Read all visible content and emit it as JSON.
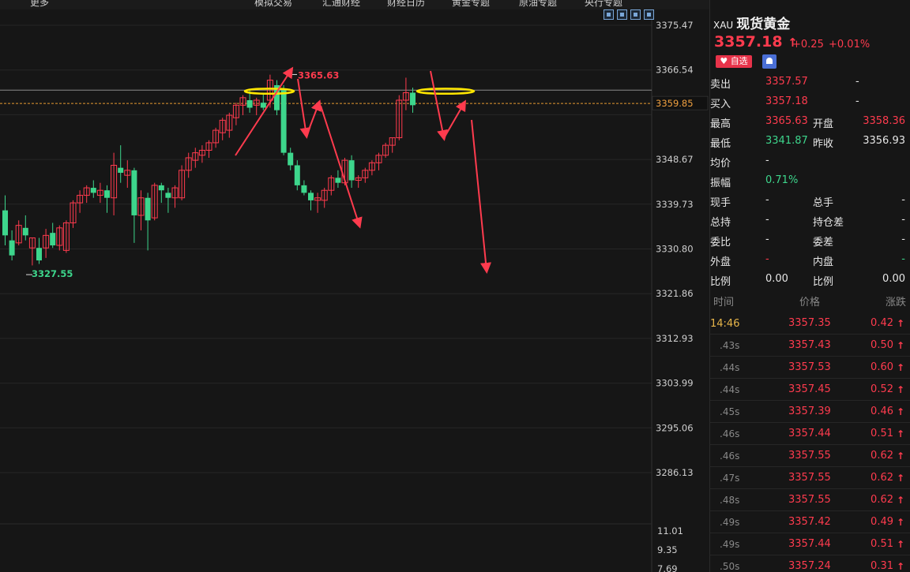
{
  "toolbar": {
    "items": [
      "更多",
      "模拟交易",
      "汇通财经",
      "财经日历",
      "黄金专题",
      "原油专题",
      "央行专题"
    ]
  },
  "chart_data": {
    "type": "candlestick",
    "y_ticks": [
      "3375.47",
      "3366.54",
      "3359.85",
      "3348.67",
      "3339.73",
      "3330.80",
      "3321.86",
      "3312.93",
      "3303.99",
      "3295.06",
      "3286.13"
    ],
    "volume_ticks": [
      "11.01",
      "9.35",
      "7.69"
    ],
    "current_price_label": "3359.85",
    "high_label": "3365.63",
    "low_label": "3327.55",
    "colors": {
      "up": "#ff3b4e",
      "down": "#3dd68c",
      "annotation": "#ff3b4e",
      "highlight": "#ffe600"
    }
  },
  "quote": {
    "code": "XAU",
    "name": "现货黄金",
    "price": "3357.18",
    "price_arrow": "↑",
    "change": "+0.25",
    "change_pct": "+0.01%",
    "fav_label": "自选",
    "stats": [
      {
        "l1": "卖出",
        "v1": "3357.57",
        "c1": "red",
        "l2": "",
        "v2": "-",
        "c2": "white"
      },
      {
        "l1": "买入",
        "v1": "3357.18",
        "c1": "red",
        "l2": "",
        "v2": "-",
        "c2": "white"
      },
      {
        "l1": "最高",
        "v1": "3365.63",
        "c1": "red",
        "l2": "开盘",
        "v2": "3358.36",
        "c2": "red"
      },
      {
        "l1": "最低",
        "v1": "3341.87",
        "c1": "green",
        "l2": "昨收",
        "v2": "3356.93",
        "c2": "white"
      },
      {
        "l1": "均价",
        "v1": "-",
        "c1": "white",
        "l2": "",
        "v2": "",
        "c2": "white"
      },
      {
        "l1": "振幅",
        "v1": "0.71%",
        "c1": "green",
        "l2": "",
        "v2": "",
        "c2": "white"
      },
      {
        "l1": "现手",
        "v1": "-",
        "c1": "white",
        "l2": "总手",
        "v2": "-",
        "c2": "white"
      },
      {
        "l1": "总持",
        "v1": "-",
        "c1": "white",
        "l2": "持仓差",
        "v2": "-",
        "c2": "white"
      },
      {
        "l1": "委比",
        "v1": "-",
        "c1": "white",
        "l2": "委差",
        "v2": "-",
        "c2": "white"
      },
      {
        "l1": "外盘",
        "v1": "-",
        "c1": "red",
        "l2": "内盘",
        "v2": "-",
        "c2": "green"
      },
      {
        "l1": "比例",
        "v1": "0.00",
        "c1": "white",
        "l2": "比例",
        "v2": "0.00",
        "c2": "white"
      }
    ]
  },
  "ticks": {
    "headers": [
      "时间",
      "价格",
      "涨跌"
    ],
    "rows": [
      {
        "time": "14:46",
        "price": "3357.35",
        "diff": "0.42"
      },
      {
        "time": ".43s",
        "price": "3357.43",
        "diff": "0.50"
      },
      {
        "time": ".44s",
        "price": "3357.53",
        "diff": "0.60"
      },
      {
        "time": ".44s",
        "price": "3357.45",
        "diff": "0.52"
      },
      {
        "time": ".45s",
        "price": "3357.39",
        "diff": "0.46"
      },
      {
        "time": ".46s",
        "price": "3357.44",
        "diff": "0.51"
      },
      {
        "time": ".46s",
        "price": "3357.55",
        "diff": "0.62"
      },
      {
        "time": ".47s",
        "price": "3357.55",
        "diff": "0.62"
      },
      {
        "time": ".48s",
        "price": "3357.55",
        "diff": "0.62"
      },
      {
        "time": ".49s",
        "price": "3357.42",
        "diff": "0.49"
      },
      {
        "time": ".49s",
        "price": "3357.44",
        "diff": "0.51"
      },
      {
        "time": ".50s",
        "price": "3357.24",
        "diff": "0.31"
      }
    ]
  }
}
